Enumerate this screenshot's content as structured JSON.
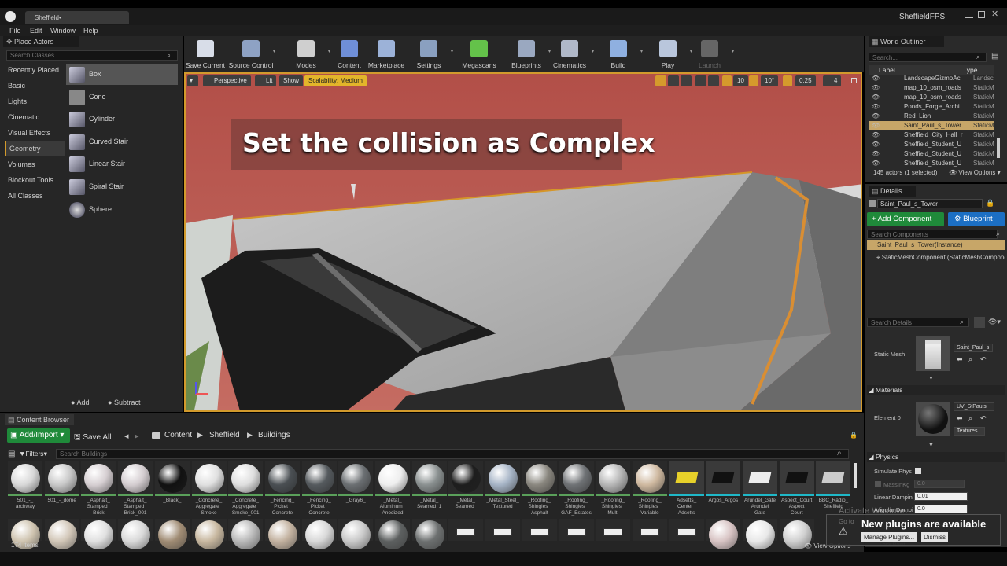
{
  "window": {
    "tab": "Sheffield•",
    "project": "SheffieldFPS"
  },
  "menu": [
    "File",
    "Edit",
    "Window",
    "Help"
  ],
  "place_actors": {
    "title": "Place Actors",
    "search_placeholder": "Search Classes",
    "categories": [
      "Recently Placed",
      "Basic",
      "Lights",
      "Cinematic",
      "Visual Effects",
      "Geometry",
      "Volumes",
      "Blockout Tools",
      "All Classes"
    ],
    "selected_category": "Geometry",
    "actors": [
      "Box",
      "Cone",
      "Cylinder",
      "Curved Stair",
      "Linear Stair",
      "Spiral Stair",
      "Sphere"
    ],
    "add_label": "Add",
    "subtract_label": "Subtract"
  },
  "toolbar": [
    {
      "label": "Save Current",
      "icon": "save-icon",
      "color": "#d8dde8"
    },
    {
      "label": "Source Control",
      "icon": "source-control-icon",
      "color": "#8ea2c4"
    },
    {
      "label": "Modes",
      "icon": "modes-icon",
      "color": "#cfcfcf"
    },
    {
      "label": "Content",
      "icon": "content-icon",
      "color": "#6f8fd8"
    },
    {
      "label": "Marketplace",
      "icon": "marketplace-icon",
      "color": "#9cb2d8"
    },
    {
      "label": "Settings",
      "icon": "settings-icon",
      "color": "#8aa0c0"
    },
    {
      "label": "Megascans",
      "icon": "megascans-icon",
      "color": "#64c24a"
    },
    {
      "label": "Blueprints",
      "icon": "blueprints-icon",
      "color": "#9aa8c0"
    },
    {
      "label": "Cinematics",
      "icon": "cinematics-icon",
      "color": "#b0b8c8"
    },
    {
      "label": "Build",
      "icon": "build-icon",
      "color": "#8fb0e0"
    },
    {
      "label": "Play",
      "icon": "play-icon",
      "color": "#b9c6dc"
    },
    {
      "label": "Launch",
      "icon": "launch-icon",
      "color": "#666666"
    }
  ],
  "viewport": {
    "perspective": "Perspective",
    "lit": "Lit",
    "show": "Show",
    "scalability": "Scalability: Medium",
    "grid_snap": "10",
    "rotation_snap": "10°",
    "scale_snap": "0.25",
    "camera_speed": "4",
    "caption": "Set the collision as Complex"
  },
  "outliner": {
    "title": "World Outliner",
    "search_placeholder": "Search...",
    "col_label": "Label",
    "col_type": "Type",
    "rows": [
      {
        "name": "LandscapeGizmoAc",
        "type": "LandscapeGi"
      },
      {
        "name": "map_10_osm_roads",
        "type": "StaticMeshA"
      },
      {
        "name": "map_10_osm_roads",
        "type": "StaticMeshA"
      },
      {
        "name": "Ponds_Forge_Archi",
        "type": "StaticMeshA"
      },
      {
        "name": "Red_Lion",
        "type": "StaticMeshA"
      },
      {
        "name": "Saint_Paul_s_Tower",
        "type": "StaticMeshA"
      },
      {
        "name": "Sheffield_City_Hall_r",
        "type": "StaticMeshA"
      },
      {
        "name": "Sheffield_Student_U",
        "type": "StaticMeshA"
      },
      {
        "name": "Sheffield_Student_U",
        "type": "StaticMeshA"
      },
      {
        "name": "Sheffield_Student_U",
        "type": "StaticMeshA"
      }
    ],
    "selected_index": 5,
    "status": "145 actors (1 selected)",
    "view_options": "View Options"
  },
  "details": {
    "title": "Details",
    "actor_name": "Saint_Paul_s_Tower",
    "add_component": "+ Add Component",
    "blueprint": "Blueprint",
    "search_components": "Search Components",
    "instance": "Saint_Paul_s_Tower(Instance)",
    "component": "StaticMeshComponent (StaticMeshComponent)",
    "search_details": "Search Details",
    "static_mesh_label": "Static Mesh",
    "static_mesh_value": "Saint_Paul_s",
    "materials_header": "Materials",
    "element0": "Element 0",
    "material_value": "UV_StPauls",
    "textures": "Textures",
    "physics_header": "Physics",
    "simulate_physics": "Simulate Phys",
    "mass_kg": "MassInKg",
    "mass_value": "0.0",
    "linear_damping": "Linear Dampin",
    "linear_value": "0.01",
    "angular_damping": "Angular Dampi",
    "angular_value": "0.0"
  },
  "content_browser": {
    "title": "Content Browser",
    "add_import": "Add/Import",
    "save_all": "Save All",
    "path": [
      "Content",
      "Sheffield",
      "Buildings"
    ],
    "filters": "Filters",
    "search_placeholder": "Search Buildings",
    "items_count": "174 items",
    "view_options": "View Options",
    "assets": [
      {
        "label": "501_-_\narchway",
        "color": "#d8d8d8"
      },
      {
        "label": "501_-_dome",
        "color": "#c8c8c8"
      },
      {
        "label": "_Asphalt_\nStamped_\nBrick",
        "color": "#d6cfd2"
      },
      {
        "label": "_Asphalt_\nStamped_\nBrick_001",
        "color": "#d4cdd0"
      },
      {
        "label": "_Black_",
        "color": "#111111"
      },
      {
        "label": "_Concrete_\nAggregate_\nSmoke",
        "color": "#e0e0e0"
      },
      {
        "label": "_Concrete_\nAggregate_\nSmoke_001",
        "color": "#dedede"
      },
      {
        "label": "_Fencing_\nPicket_\nConcrete",
        "color": "#4a4f53"
      },
      {
        "label": "_Fencing_\nPicket_\nConcrete",
        "color": "#555a5e"
      },
      {
        "label": "_Gray6_",
        "color": "#6b6f72"
      },
      {
        "label": "_Metal_\nAluminum_\nAnodized",
        "color": "#eeeeee"
      },
      {
        "label": "_Metal_\nSeamed_1",
        "color": "#8a9090"
      },
      {
        "label": "_Metal_\nSeamed_",
        "color": "#1e1e1e"
      },
      {
        "label": "_Metal_Steel_\nTextured",
        "color": "#a6b4c6"
      },
      {
        "label": "_Roofing_\nShingles_\nAsphalt",
        "color": "#8a877f"
      },
      {
        "label": "_Roofing_\nShingles_\nGAF_Estates",
        "color": "#6f7275"
      },
      {
        "label": "_Roofing_\nShingles_\nMulti",
        "color": "#b6b6b6"
      },
      {
        "label": "_Roofing_\nShingles_\nVariable",
        "color": "#cfb9a0"
      },
      {
        "label": "Adsetts_\nCenter_\nAdsetts",
        "color": "mesh-yellow"
      },
      {
        "label": "Argos_Argos",
        "color": "mesh-dark"
      },
      {
        "label": "Arundel_Gate\n_Arundel_\nGate",
        "color": "mesh-white"
      },
      {
        "label": "Aspect_Court\n_Aspect_\nCourt",
        "color": "mesh-dark"
      },
      {
        "label": "BBC_Radio_\nSheffield",
        "color": "mesh-gray"
      }
    ]
  },
  "notification": {
    "title": "New plugins are available",
    "manage": "Manage Plugins...",
    "dismiss": "Dismiss",
    "watermark": "Activate Windows",
    "watermark_sub": "Go to"
  },
  "misc": {
    "lock_row": "Lock Posit"
  }
}
